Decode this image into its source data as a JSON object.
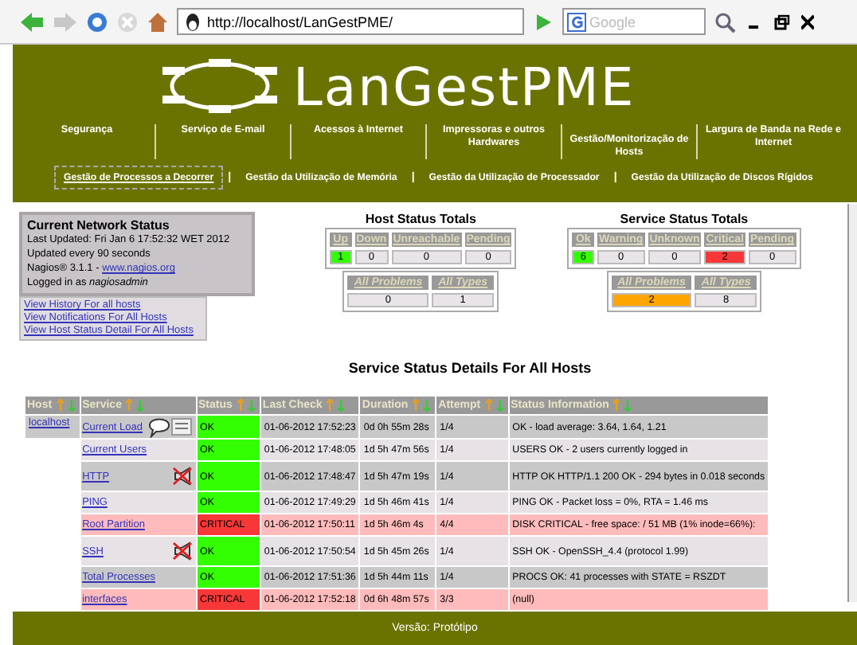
{
  "browser": {
    "url": "http://localhost/LanGestPME/",
    "search_placeholder": "Google"
  },
  "header": {
    "logo": "LanGestPME",
    "nav_main": [
      "Segurança",
      "Serviço de E-mail",
      "Acessos à Internet",
      "Impressoras e outros Hardwares",
      "Gestão/Monitorização de Hosts",
      "Largura de Banda na Rede e Internet"
    ],
    "nav_sub": [
      {
        "label": "Gestão de Processos a Decorrer",
        "selected": true
      },
      {
        "label": "Gestão da Utilização de Memória",
        "selected": false
      },
      {
        "label": "Gestão da Utilização de Processador",
        "selected": false
      },
      {
        "label": "Gestão da Utilização de Discos Rígidos",
        "selected": false
      }
    ],
    "separator": "|"
  },
  "network_status": {
    "title": "Current Network Status",
    "lines": [
      "Last Updated: Fri Jan 6 17:52:32 WET 2012",
      "Updated every 90 seconds"
    ],
    "version": "Nagios® 3.1.1 - ",
    "version_link": "www.nagios.org",
    "login": "Logged in as *nagiosadmin*"
  },
  "links": [
    "View History For all hosts",
    "View Notifications For All Hosts",
    "View Host Status Detail For All Hosts"
  ],
  "host_totals": {
    "title": "Host Status Totals",
    "cells": [
      {
        "label": "Up",
        "value": "1",
        "color": "#33ff00"
      },
      {
        "label": "Down",
        "value": "0",
        "color": "#e8e4e8"
      },
      {
        "label": "Unreachable",
        "value": "0",
        "color": "#e8e4e8"
      },
      {
        "label": "Pending",
        "value": "0",
        "color": "#e8e4e8"
      }
    ],
    "summary": [
      {
        "label": "All Problems",
        "value": "0",
        "color": "#e8e4e8"
      },
      {
        "label": "All Types",
        "value": "1",
        "color": "#e8e4e8"
      }
    ]
  },
  "service_totals": {
    "title": "Service Status Totals",
    "cells": [
      {
        "label": "Ok",
        "value": "6",
        "color": "#33ff00"
      },
      {
        "label": "Warning",
        "value": "0",
        "color": "#e8e4e8"
      },
      {
        "label": "Unknown",
        "value": "0",
        "color": "#e8e4e8"
      },
      {
        "label": "Critical",
        "value": "2",
        "color": "#f83838"
      },
      {
        "label": "Pending",
        "value": "0",
        "color": "#e8e4e8"
      }
    ],
    "summary": [
      {
        "label": "All Problems",
        "value": "2",
        "color": "#ffa500"
      },
      {
        "label": "All Types",
        "value": "8",
        "color": "#e8e4e8"
      }
    ]
  },
  "details": {
    "title": "Service Status Details For All Hosts",
    "columns": [
      "Host",
      "Service",
      "Status",
      "Last Check",
      "Duration",
      "Attempt",
      "Status Information"
    ],
    "rows": [
      {
        "host": "localhost",
        "service": "Current Load",
        "icons": [
          {
            "kind": "comment"
          },
          {
            "kind": "details"
          }
        ],
        "status": "OK",
        "kind": "ok",
        "last_check": "01-06-2012 17:52:23",
        "duration": "0d 0h 55m 28s",
        "attempt": "1/4",
        "info": "OK - load average: 3.64, 1.64, 1.21"
      },
      {
        "service": "Current Users",
        "icons": [],
        "status": "OK",
        "kind": "ok",
        "last_check": "01-06-2012 17:48:05",
        "duration": "1d 5h 47m 56s",
        "attempt": "1/4",
        "info": "USERS OK - 2 users currently logged in"
      },
      {
        "service": "HTTP",
        "icons": [
          {
            "kind": "muted"
          }
        ],
        "status": "OK",
        "kind": "ok",
        "last_check": "01-06-2012 17:48:47",
        "duration": "1d 5h 47m 19s",
        "attempt": "1/4",
        "info": "HTTP OK HTTP/1.1 200 OK - 294 bytes in 0.018 seconds"
      },
      {
        "service": "PING",
        "icons": [],
        "status": "OK",
        "kind": "ok",
        "last_check": "01-06-2012 17:49:29",
        "duration": "1d 5h 46m 41s",
        "attempt": "1/4",
        "info": "PING OK - Packet loss = 0%, RTA = 1.46 ms"
      },
      {
        "service": "Root Partition",
        "icons": [],
        "status": "CRITICAL",
        "kind": "critical",
        "last_check": "01-06-2012 17:50:11",
        "duration": "1d 5h 46m 4s",
        "attempt": "4/4",
        "info": "DISK CRITICAL - free space: / 51 MB (1% inode=66%):"
      },
      {
        "service": "SSH",
        "icons": [
          {
            "kind": "muted"
          }
        ],
        "status": "OK",
        "kind": "ok",
        "last_check": "01-06-2012 17:50:54",
        "duration": "1d 5h 45m 26s",
        "attempt": "1/4",
        "info": "SSH OK - OpenSSH_4.4 (protocol 1.99)"
      },
      {
        "service": "Total Processes",
        "icons": [],
        "status": "OK",
        "kind": "ok",
        "last_check": "01-06-2012 17:51:36",
        "duration": "1d 5h 44m 11s",
        "attempt": "1/4",
        "info": "PROCS OK: 41 processes with STATE = RSZDT"
      },
      {
        "service": "interfaces",
        "icons": [],
        "status": "CRITICAL",
        "kind": "critical",
        "last_check": "01-06-2012 17:52:18",
        "duration": "0d 6h 48m 57s",
        "attempt": "3/3",
        "info": "(null)"
      }
    ]
  },
  "footer": "Versão: Protótipo"
}
